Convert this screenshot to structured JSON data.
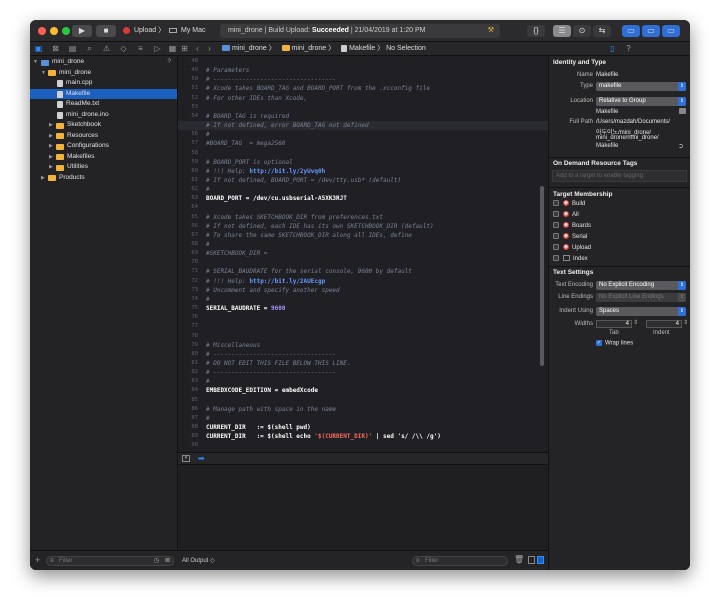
{
  "window": {
    "scheme_target": "Upload",
    "scheme_device": "My Mac",
    "activity_project": "mini_drone",
    "activity_status_prefix": "Build Upload:",
    "activity_status": "Succeeded",
    "activity_time": "21/04/2019 at 1:20 PM"
  },
  "breadcrumbs": [
    "mini_drone",
    "mini_drone",
    "Makefile",
    "No Selection"
  ],
  "navigator": {
    "items": [
      {
        "label": "mini_drone",
        "kind": "project",
        "badge": "?"
      },
      {
        "label": "mini_drone",
        "kind": "folder"
      },
      {
        "label": "main.cpp",
        "kind": "file"
      },
      {
        "label": "Makefile",
        "kind": "file",
        "selected": true
      },
      {
        "label": "ReadMe.txt",
        "kind": "file"
      },
      {
        "label": "mini_drone.ino",
        "kind": "file"
      },
      {
        "label": "Sketchbook",
        "kind": "folder"
      },
      {
        "label": "Resources",
        "kind": "folder"
      },
      {
        "label": "Configurations",
        "kind": "folder"
      },
      {
        "label": "Makefiles",
        "kind": "folder"
      },
      {
        "label": "Utilities",
        "kind": "folder"
      },
      {
        "label": "Products",
        "kind": "folder"
      }
    ],
    "filter_placeholder": "Filter"
  },
  "editor": {
    "current_line": 55,
    "lines": [
      {
        "n": "48",
        "t": "",
        "k": "p"
      },
      {
        "n": "49",
        "t": "# Parameters",
        "k": "c"
      },
      {
        "n": "50",
        "t": "# ----------------------------------",
        "k": "c"
      },
      {
        "n": "51",
        "t": "# Xcode takes BOARD_TAG and BOARD_PORT from the .xcconfig file",
        "k": "c"
      },
      {
        "n": "52",
        "t": "# For other IDEs than Xcode,",
        "k": "c"
      },
      {
        "n": "53",
        "t": "",
        "k": "p"
      },
      {
        "n": "54",
        "t": "# BOARD_TAG is required",
        "k": "c"
      },
      {
        "n": "55",
        "t": "# If not defined, error BOARD_TAG not defined",
        "k": "c"
      },
      {
        "n": "56",
        "t": "#",
        "k": "c"
      },
      {
        "n": "57",
        "t": "#BOARD_TAG  = mega2560",
        "k": "c"
      },
      {
        "n": "58",
        "t": "",
        "k": "p"
      },
      {
        "n": "59",
        "t": "# BOARD_PORT is optional",
        "k": "c"
      },
      {
        "n": "60",
        "t": "# !!! Help: ",
        "k": "c",
        "url": "http://bit.ly/2yUvq0h"
      },
      {
        "n": "61",
        "t": "# If not defined, BOARD_PORT = /dev/tty.usb* (default)",
        "k": "c"
      },
      {
        "n": "62",
        "t": "#",
        "k": "c"
      },
      {
        "n": "63",
        "t": "BOARD_PORT = /dev/cu.usbserial-A5XK3RJT",
        "k": "d"
      },
      {
        "n": "64",
        "t": "",
        "k": "p"
      },
      {
        "n": "65",
        "t": "# Xcode takes SKETCHBOOK_DIR from preferences.txt",
        "k": "c"
      },
      {
        "n": "66",
        "t": "# If not defined, each IDE has its own SKETCHBOOK_DIR (default)",
        "k": "c"
      },
      {
        "n": "67",
        "t": "# To share the same SKETCHBOOK_DIR along all IDEs, define",
        "k": "c"
      },
      {
        "n": "68",
        "t": "#",
        "k": "c"
      },
      {
        "n": "69",
        "t": "#SKETCHBOOK_DIR =",
        "k": "c"
      },
      {
        "n": "70",
        "t": "",
        "k": "p"
      },
      {
        "n": "71",
        "t": "# SERIAL_BAUDRATE for the serial console, 9600 by default",
        "k": "c"
      },
      {
        "n": "72",
        "t": "# !!! Help: ",
        "k": "c",
        "url": "http://bit.ly/2AUEcgp"
      },
      {
        "n": "73",
        "t": "# Uncomment and specify another speed",
        "k": "c"
      },
      {
        "n": "74",
        "t": "#",
        "k": "c"
      },
      {
        "n": "75",
        "t": "SERIAL_BAUDRATE = ",
        "k": "d",
        "num": "9600"
      },
      {
        "n": "76",
        "t": "",
        "k": "p"
      },
      {
        "n": "77",
        "t": "",
        "k": "p"
      },
      {
        "n": "78",
        "t": "",
        "k": "p"
      },
      {
        "n": "79",
        "t": "# Miscellaneous",
        "k": "c"
      },
      {
        "n": "80",
        "t": "# ----------------------------------",
        "k": "c"
      },
      {
        "n": "81",
        "t": "# DO NOT EDIT THIS FILE BELOW THIS LINE.",
        "k": "c"
      },
      {
        "n": "82",
        "t": "# ----------------------------------",
        "k": "c"
      },
      {
        "n": "83",
        "t": "#",
        "k": "c"
      },
      {
        "n": "84",
        "t": "EMBEDXCODE_EDITION = embedXcode",
        "k": "d"
      },
      {
        "n": "85",
        "t": "",
        "k": "p"
      },
      {
        "n": "86",
        "t": "# Manage path with space in the name",
        "k": "c"
      },
      {
        "n": "87",
        "t": "#",
        "k": "c"
      },
      {
        "n": "88",
        "t": "CURRENT_DIR   := $(shell pwd)",
        "k": "d"
      },
      {
        "n": "89",
        "t": "CURRENT_DIR   := $(shell echo ",
        "k": "d",
        "str": "'$(CURRENT_DIR)'",
        "tail": " | sed 's/ /\\\\ /g')"
      },
      {
        "n": "90",
        "t": "",
        "k": "p"
      }
    ]
  },
  "console": {
    "output_selector": "All Output",
    "filter_placeholder": "Filter"
  },
  "inspector": {
    "identity_header": "Identity and Type",
    "name_label": "Name",
    "name_value": "Makefile",
    "type_label": "Type",
    "type_value": "makefile",
    "location_label": "Location",
    "location_value": "Relative to Group",
    "location_file": "Makefile",
    "fullpath_label": "Full Path",
    "fullpath_lines": [
      "/Users/mazdah/Documents/",
      "아두이노/mini_drone/",
      "mini_drone/mini_drone/",
      "Makefile"
    ],
    "odr_header": "On Demand Resource Tags",
    "odr_placeholder": "Add to a target to enable tagging",
    "tm_header": "Target Membership",
    "targets": [
      "Build",
      "All",
      "Boards",
      "Serial",
      "Upload",
      "Index"
    ],
    "ts_header": "Text Settings",
    "encoding_label": "Text Encoding",
    "encoding_value": "No Explicit Encoding",
    "line_endings_label": "Line Endings",
    "line_endings_value": "No Explicit Line Endings",
    "indent_using_label": "Indent Using",
    "indent_using_value": "Spaces",
    "widths_label": "Widths",
    "tab_width": "4",
    "indent_width": "4",
    "tab_label": "Tab",
    "indent_label": "Indent",
    "wrap_label": "Wrap lines"
  },
  "colors": {
    "selection": "#1b5fbf",
    "accent": "#2f6fd6",
    "folder": "#f2b33d",
    "comment": "#7a8294",
    "url": "#6699ff",
    "error_badge": "#d93a36"
  }
}
